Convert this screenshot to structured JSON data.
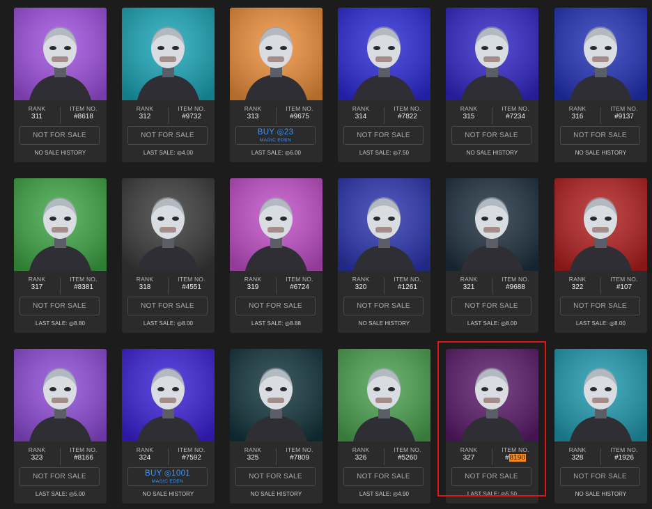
{
  "labels": {
    "rank": "RANK",
    "item_no": "ITEM NO."
  },
  "sol_symbol": "◎",
  "colors": {
    "page_bg": "#1c1c1c",
    "card_bg": "#2b2b2b",
    "buy_blue": "#3d97ff",
    "selection_red": "#e01616",
    "highlight": "#ff8a1a"
  },
  "cards": [
    {
      "rank": "311",
      "item": "#8618",
      "status": "NOT FOR SALE",
      "sale": "NO SALE HISTORY",
      "bg": "#a050e0"
    },
    {
      "rank": "312",
      "item": "#9732",
      "status": "NOT FOR SALE",
      "sale": "LAST SALE: ◎4.00",
      "bg": "#1aa6b8"
    },
    {
      "rank": "313",
      "item": "#9675",
      "status": "BUY ◎23",
      "buy_sub": "MAGIC EDEN",
      "sale": "LAST SALE: ◎6.00",
      "bg": "#ee8f3a"
    },
    {
      "rank": "314",
      "item": "#7822",
      "status": "NOT FOR SALE",
      "sale": "LAST SALE: ◎7.50",
      "bg": "#2c2ad8"
    },
    {
      "rank": "315",
      "item": "#7234",
      "status": "NOT FOR SALE",
      "sale": "NO SALE HISTORY",
      "bg": "#3325c8"
    },
    {
      "rank": "316",
      "item": "#9137",
      "status": "NOT FOR SALE",
      "sale": "NO SALE HISTORY",
      "bg": "#2332b8"
    },
    {
      "rank": "317",
      "item": "#8381",
      "status": "NOT FOR SALE",
      "sale": "LAST SALE: ◎8.80",
      "bg": "#3fa646"
    },
    {
      "rank": "318",
      "item": "#4551",
      "status": "NOT FOR SALE",
      "sale": "LAST SALE: ◎8.00",
      "bg": "#3a3a3a"
    },
    {
      "rank": "319",
      "item": "#6724",
      "status": "NOT FOR SALE",
      "sale": "LAST SALE: ◎8.88",
      "bg": "#c24ec9"
    },
    {
      "rank": "320",
      "item": "#1261",
      "status": "NOT FOR SALE",
      "sale": "NO SALE HISTORY",
      "bg": "#2a34b0"
    },
    {
      "rank": "321",
      "item": "#9688",
      "status": "NOT FOR SALE",
      "sale": "LAST SALE: ◎8.00",
      "bg": "#1e3040"
    },
    {
      "rank": "322",
      "item": "#107",
      "status": "NOT FOR SALE",
      "sale": "LAST SALE: ◎8.00",
      "bg": "#b31f1f"
    },
    {
      "rank": "323",
      "item": "#8166",
      "status": "NOT FOR SALE",
      "sale": "LAST SALE: ◎5.00",
      "bg": "#8f4bd8"
    },
    {
      "rank": "324",
      "item": "#7592",
      "status": "BUY ◎1001",
      "buy_sub": "MAGIC EDEN",
      "sale": "NO SALE HISTORY",
      "bg": "#3b20d8"
    },
    {
      "rank": "325",
      "item": "#7809",
      "status": "NOT FOR SALE",
      "sale": "NO SALE HISTORY",
      "bg": "#12343c"
    },
    {
      "rank": "326",
      "item": "#5260",
      "status": "NOT FOR SALE",
      "sale": "LAST SALE: ◎4.90",
      "bg": "#4aa24e"
    },
    {
      "rank": "327",
      "item_prefix": "#",
      "item_highlight": "8190",
      "status": "NOT FOR SALE",
      "sale": "LAST SALE: ◎5.50",
      "bg": "#5a1a6a"
    },
    {
      "rank": "328",
      "item": "#1926",
      "status": "NOT FOR SALE",
      "sale": "NO SALE HISTORY",
      "bg": "#1f9ab0"
    }
  ]
}
